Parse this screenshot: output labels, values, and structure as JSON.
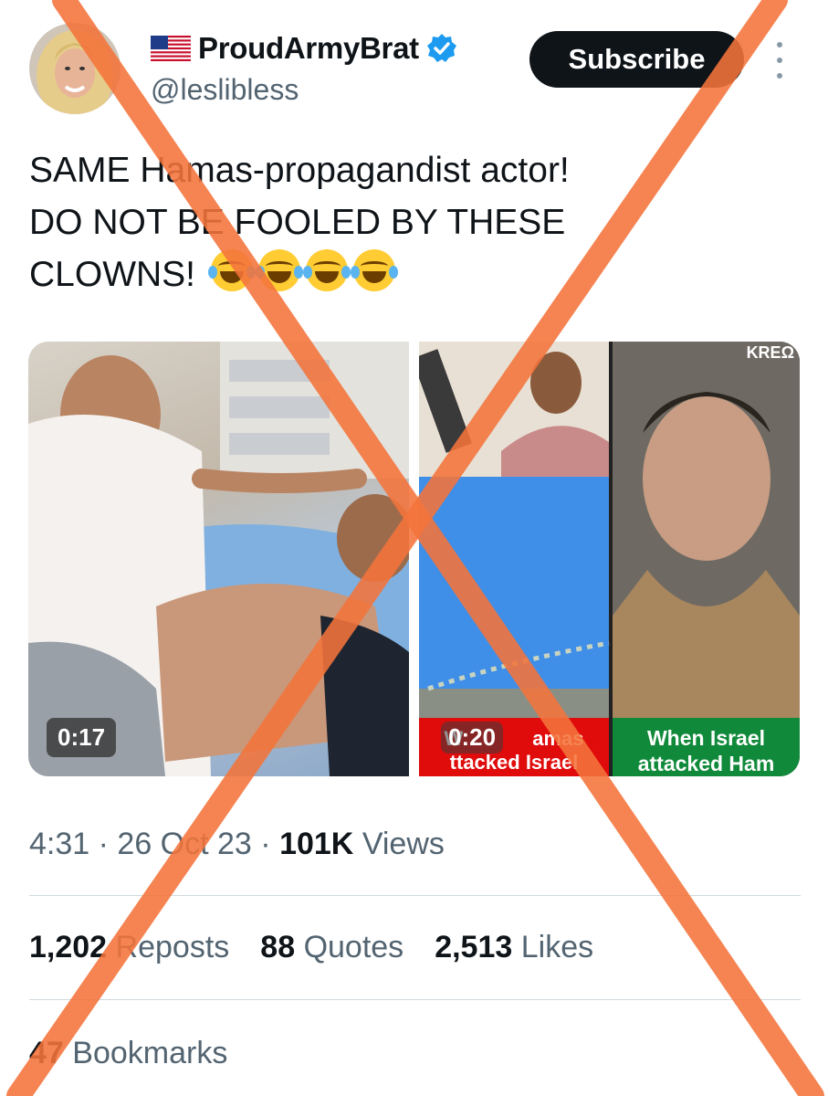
{
  "author": {
    "flag_icon": "us-flag-icon",
    "display_name": "ProudArmyBrat",
    "handle": "@leslibless",
    "verified_icon": "verified-badge-icon",
    "verified_color": "#1d9bf0"
  },
  "actions": {
    "subscribe_label": "Subscribe",
    "more_icon": "more-options-icon"
  },
  "tweet": {
    "line1": "SAME Hamas-propagandist actor!",
    "line2": "DO NOT BE FOOLED BY THESE",
    "line3": "CLOWNS!",
    "emoji_icon": "face-with-tears-of-joy-icon",
    "emoji_count": 4
  },
  "media": {
    "video1": {
      "duration": "0:17"
    },
    "video2": {
      "duration": "0:20",
      "watermark": "KREΩ",
      "caption_left_line1": "W",
      "caption_left_line1_end": "amas",
      "caption_left_line2": "ttacked Israel",
      "caption_right_line1": "When Israel",
      "caption_right_line2": "attacked Ham"
    }
  },
  "meta": {
    "time": "4:31",
    "date": "26 Oct 23",
    "views_count": "101K",
    "views_label": "Views",
    "separator": "·"
  },
  "stats": {
    "reposts_count": "1,202",
    "reposts_label": "Reposts",
    "quotes_count": "88",
    "quotes_label": "Quotes",
    "likes_count": "2,513",
    "likes_label": "Likes",
    "bookmarks_count": "47",
    "bookmarks_label": "Bookmarks"
  },
  "overlay": {
    "cross_color": "#f4743b"
  }
}
